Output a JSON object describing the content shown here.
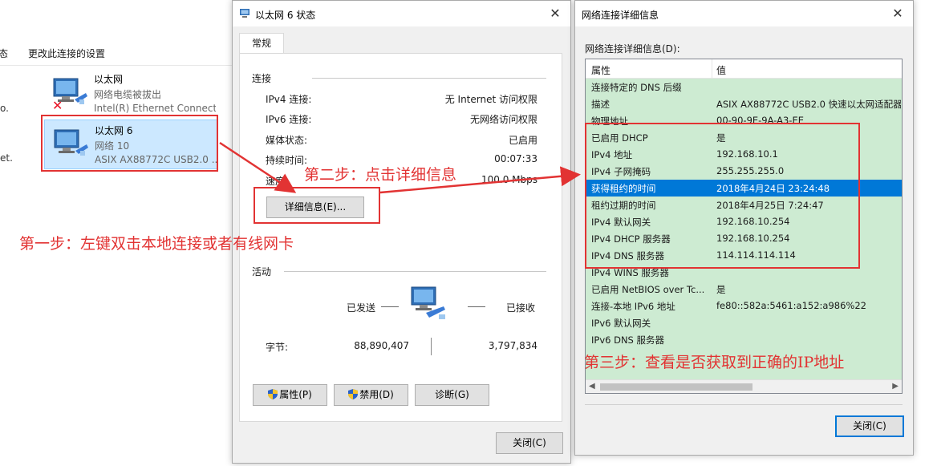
{
  "background": {
    "toolbar_frag": "态",
    "toolbar_change_settings": "更改此连接的设置",
    "side_frag1": "o.",
    "side_frag2": "et.",
    "adapters": [
      {
        "name": "以太网",
        "status": "网络电缆被拔出",
        "device": "Intel(R) Ethernet Connect..."
      },
      {
        "name": "以太网 6",
        "status": "网络  10",
        "device": "ASIX AX88772C USB2.0 ..."
      }
    ]
  },
  "status_dialog": {
    "title": "以太网 6 状态",
    "tab_general": "常规",
    "group_connection": "连接",
    "rows": [
      {
        "label": "IPv4 连接:",
        "value": "无 Internet 访问权限"
      },
      {
        "label": "IPv6 连接:",
        "value": "无网络访问权限"
      },
      {
        "label": "媒体状态:",
        "value": "已启用"
      },
      {
        "label": "持续时间:",
        "value": "00:07:33"
      },
      {
        "label": "速度:",
        "value": "100.0 Mbps"
      }
    ],
    "details_button": "详细信息(E)...",
    "group_activity": "活动",
    "sent_label": "已发送",
    "received_label": "已接收",
    "bytes_label": "字节:",
    "bytes_sent": "88,890,407",
    "bytes_received": "3,797,834",
    "properties_button": "属性(P)",
    "disable_button": "禁用(D)",
    "diagnose_button": "诊断(G)",
    "close_button": "关闭(C)"
  },
  "details_dialog": {
    "title": "网络连接详细信息",
    "list_label": "网络连接详细信息(D):",
    "col_property": "属性",
    "col_value": "值",
    "rows": [
      {
        "p": "连接特定的 DNS 后缀",
        "v": ""
      },
      {
        "p": "描述",
        "v": "ASIX AX88772C USB2.0 快速以太网适配器"
      },
      {
        "p": "物理地址",
        "v": "00-90-9E-9A-A3-EE"
      },
      {
        "p": "已启用 DHCP",
        "v": "是"
      },
      {
        "p": "IPv4 地址",
        "v": "192.168.10.1"
      },
      {
        "p": "IPv4 子网掩码",
        "v": "255.255.255.0"
      },
      {
        "p": "获得租约的时间",
        "v": "2018年4月24日 23:24:48"
      },
      {
        "p": "租约过期的时间",
        "v": "2018年4月25日 7:24:47"
      },
      {
        "p": "IPv4 默认网关",
        "v": "192.168.10.254"
      },
      {
        "p": "IPv4 DHCP 服务器",
        "v": "192.168.10.254"
      },
      {
        "p": "IPv4 DNS 服务器",
        "v": "114.114.114.114"
      },
      {
        "p": "IPv4 WINS 服务器",
        "v": ""
      },
      {
        "p": "已启用 NetBIOS over Tc...",
        "v": "是"
      },
      {
        "p": "连接-本地 IPv6 地址",
        "v": "fe80::582a:5461:a152:a986%22"
      },
      {
        "p": "IPv6 默认网关",
        "v": ""
      },
      {
        "p": "IPv6 DNS 服务器",
        "v": ""
      }
    ],
    "selected_index": 6,
    "close_button": "关闭(C)"
  },
  "annotations": {
    "step1": "第一步：左键双击本地连接或者有线网卡",
    "step2": "第二步：点击详细信息",
    "step3": "第三步：查看是否获取到正确的IP地址"
  },
  "colors": {
    "annotation_red": "#e23333",
    "list_green": "#cdebd2",
    "selection_blue": "#0078d7"
  }
}
